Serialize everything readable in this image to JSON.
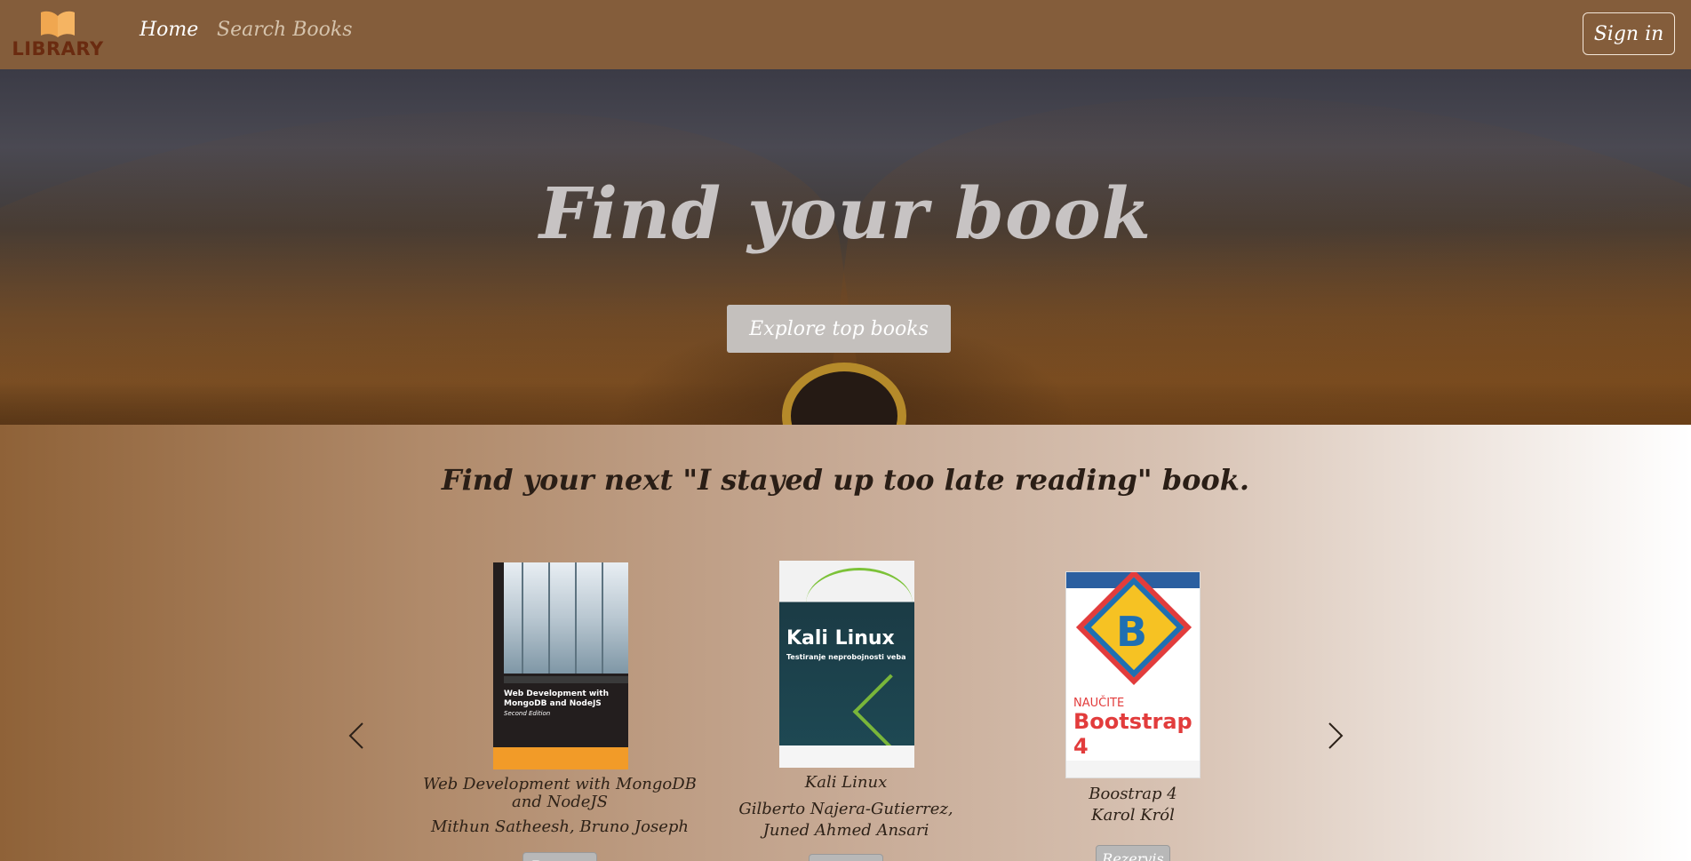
{
  "nav": {
    "logo_text": "LIBRARY",
    "links": [
      {
        "label": "Home",
        "active": true
      },
      {
        "label": "Search Books",
        "active": false
      }
    ],
    "signin_label": "Sign in"
  },
  "hero": {
    "title": "Find your book",
    "button_label": "Explore top books"
  },
  "books_section": {
    "heading": "Find your next \"I stayed up too late reading\" book.",
    "books": [
      {
        "title": "Web Development with MongoDB and NodeJS",
        "author": "Mithun Satheesh, Bruno Joseph",
        "cover_title": "Web Development with MongoDB and NodeJS",
        "cover_edition": "Second Edition",
        "button_label": "Reserve"
      },
      {
        "title": "Kali Linux",
        "author": "Gilberto Najera-Gutierrez, Juned Ahmed Ansari",
        "cover_title": "Kali Linux",
        "cover_subtitle": "Testiranje neprobojnosti veba",
        "button_label": "Reserve"
      },
      {
        "title": "Boostrap 4",
        "author": "Karol Król",
        "cover_title": "Bootstrap 4",
        "cover_kicker": "NAUČITE",
        "button_label": "Rezervis"
      }
    ]
  },
  "colors": {
    "navbar": "#845d3b",
    "logo": "#6a2b10",
    "accent_orange": "#f29b28"
  },
  "icons": [
    "book-logo-icon",
    "chevron-left-icon",
    "chevron-right-icon"
  ]
}
